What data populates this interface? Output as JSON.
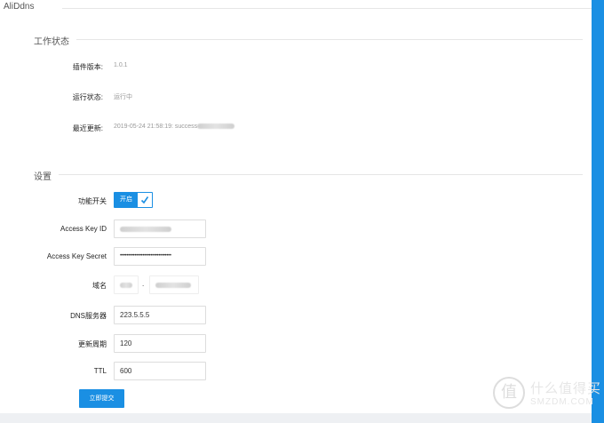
{
  "page": {
    "title": "AliDdns"
  },
  "status_section": {
    "title": "工作状态",
    "rows": [
      {
        "label": "插件版本:",
        "value": "1.0.1"
      },
      {
        "label": "运行状态:",
        "value": "运行中"
      },
      {
        "label": "最近更新:",
        "value": "2019-05-24 21:58:19: success"
      }
    ]
  },
  "settings_section": {
    "title": "设置",
    "toggle": {
      "label": "功能开关",
      "on_text": "开启"
    },
    "access_key_id": {
      "label": "Access Key ID"
    },
    "access_key_secret": {
      "label": "Access Key Secret",
      "value": "••••••••••••••••••••••••••••••••"
    },
    "domain": {
      "label": "域名",
      "separator": "."
    },
    "dns_server": {
      "label": "DNS服务器",
      "value": "223.5.5.5"
    },
    "update_period": {
      "label": "更新周期",
      "value": "120"
    },
    "ttl": {
      "label": "TTL",
      "value": "600"
    },
    "submit_label": "立即提交"
  },
  "watermark": {
    "logo": "值",
    "cn": "什么值得买",
    "en": "SMZDM.COM"
  },
  "colors": {
    "accent": "#1a8fe3",
    "border": "#dddddd"
  }
}
